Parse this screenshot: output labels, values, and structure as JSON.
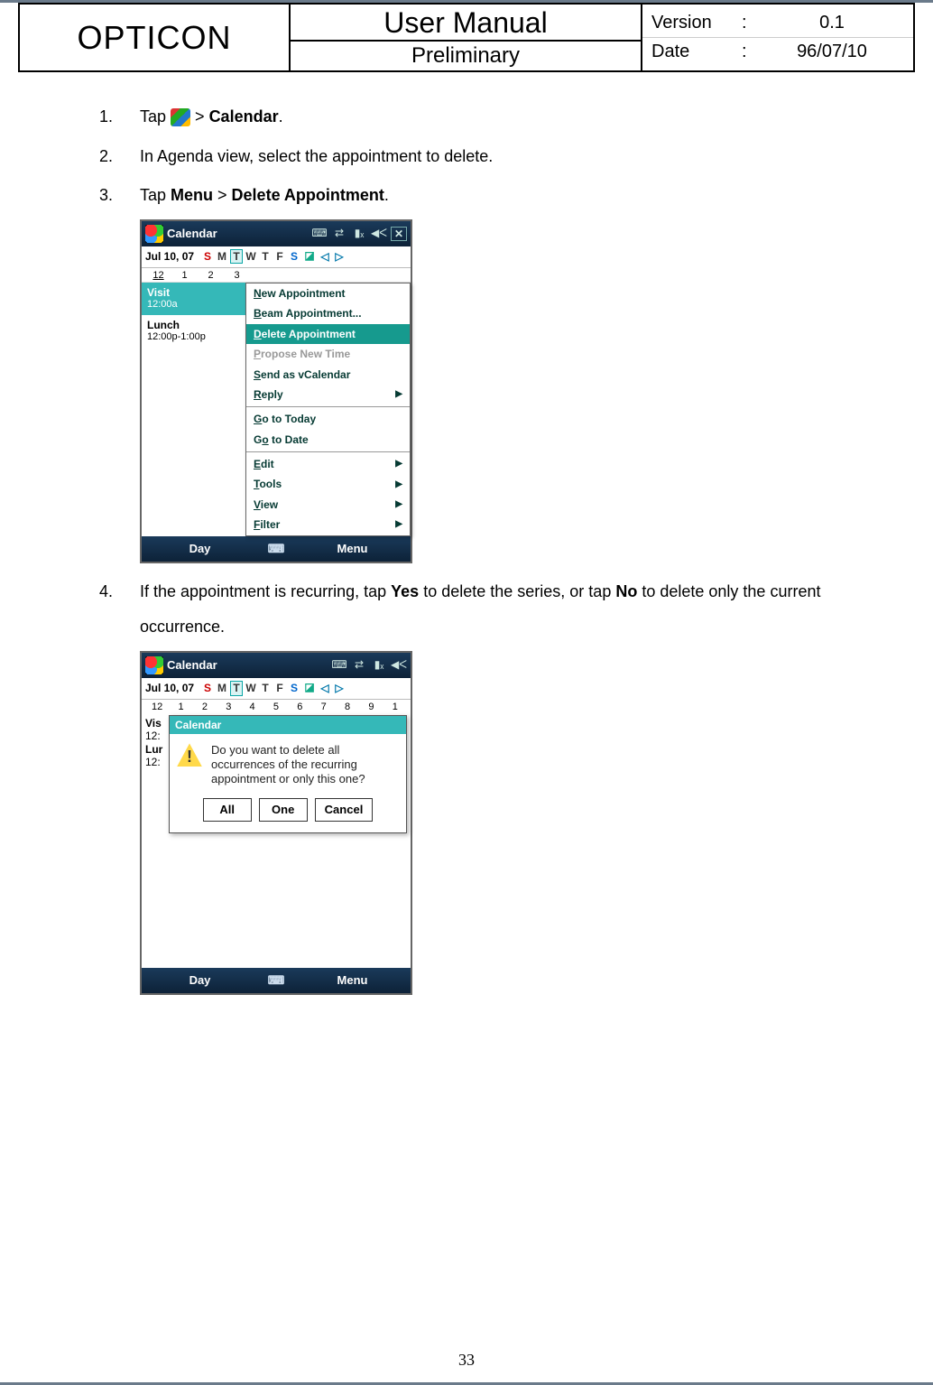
{
  "header": {
    "company": "OPTICON",
    "title": "User Manual",
    "subtitle": "Preliminary",
    "meta": [
      {
        "label": "Version",
        "value": "0.1"
      },
      {
        "label": "Date",
        "value": "96/07/10"
      }
    ]
  },
  "steps": {
    "s1": {
      "num": "1.",
      "pre": "Tap ",
      "post": " > ",
      "bold": "Calendar",
      "tail": "."
    },
    "s2": {
      "num": "2.",
      "text": "In Agenda view, select the appointment to delete."
    },
    "s3": {
      "num": "3.",
      "pre": "Tap ",
      "b1": "Menu",
      "mid": " > ",
      "b2": "Delete Appointment",
      "tail": "."
    },
    "s4": {
      "num": "4.",
      "pre": "If the appointment is recurring, tap ",
      "b1": "Yes",
      "mid": " to delete the series, or tap ",
      "b2": "No",
      "tail": " to delete only the current occurrence."
    }
  },
  "shot1": {
    "title": "Calendar",
    "date": "Jul  10, 07",
    "dow": [
      "S",
      "M",
      "T",
      "W",
      "T",
      "F",
      "S"
    ],
    "days": [
      "12",
      "1",
      "2",
      "3"
    ],
    "appts": [
      {
        "name": "Visit",
        "time": "12:00a",
        "sel": true
      },
      {
        "name": "Lunch",
        "time": "12:00p-1:00p",
        "sel": false
      }
    ],
    "menu": {
      "items": [
        {
          "label_pre": "N",
          "label_rest": "ew Appointment",
          "dim": false
        },
        {
          "label_pre": "B",
          "label_rest": "eam Appointment...",
          "dim": false
        },
        {
          "label_pre": "D",
          "label_rest": "elete Appointment",
          "sel": true
        },
        {
          "label_pre": "P",
          "label_rest": "ropose New Time",
          "dim": true
        },
        {
          "label_pre": "S",
          "label_rest": "end as vCalendar",
          "dim": false
        },
        {
          "label_pre": "R",
          "label_rest": "eply",
          "arrow": true
        }
      ],
      "group2": [
        {
          "label_pre": "G",
          "label_rest": "o to Today"
        },
        {
          "label_full": "G",
          "label_mid": "o",
          "label_rest2": " to Date",
          "second_u": true
        }
      ],
      "group3": [
        {
          "label_pre": "E",
          "label_rest": "dit",
          "arrow": true
        },
        {
          "label_pre": "T",
          "label_rest": "ools",
          "arrow": true
        },
        {
          "label_pre": "V",
          "label_rest": "iew",
          "arrow": true
        },
        {
          "label_pre": "F",
          "label_rest": "ilter",
          "arrow": true
        }
      ]
    },
    "softkeys": {
      "left": "Day",
      "right": "Menu"
    }
  },
  "shot2": {
    "title": "Calendar",
    "date": "Jul  10, 07",
    "dow": [
      "S",
      "M",
      "T",
      "W",
      "T",
      "F",
      "S"
    ],
    "days": [
      "12",
      "1",
      "2",
      "3",
      "4",
      "5",
      "6",
      "7",
      "8",
      "9",
      "1"
    ],
    "behind": [
      {
        "name": "Vis",
        "time": "12:"
      },
      {
        "name": "Lur",
        "time": "12:"
      }
    ],
    "dialog": {
      "title": "Calendar",
      "message": "Do you want to delete all occurrences of the recurring appointment or only this one?",
      "buttons": [
        "All",
        "One",
        "Cancel"
      ]
    },
    "softkeys": {
      "left": "Day",
      "right": "Menu"
    }
  },
  "page_number": "33"
}
